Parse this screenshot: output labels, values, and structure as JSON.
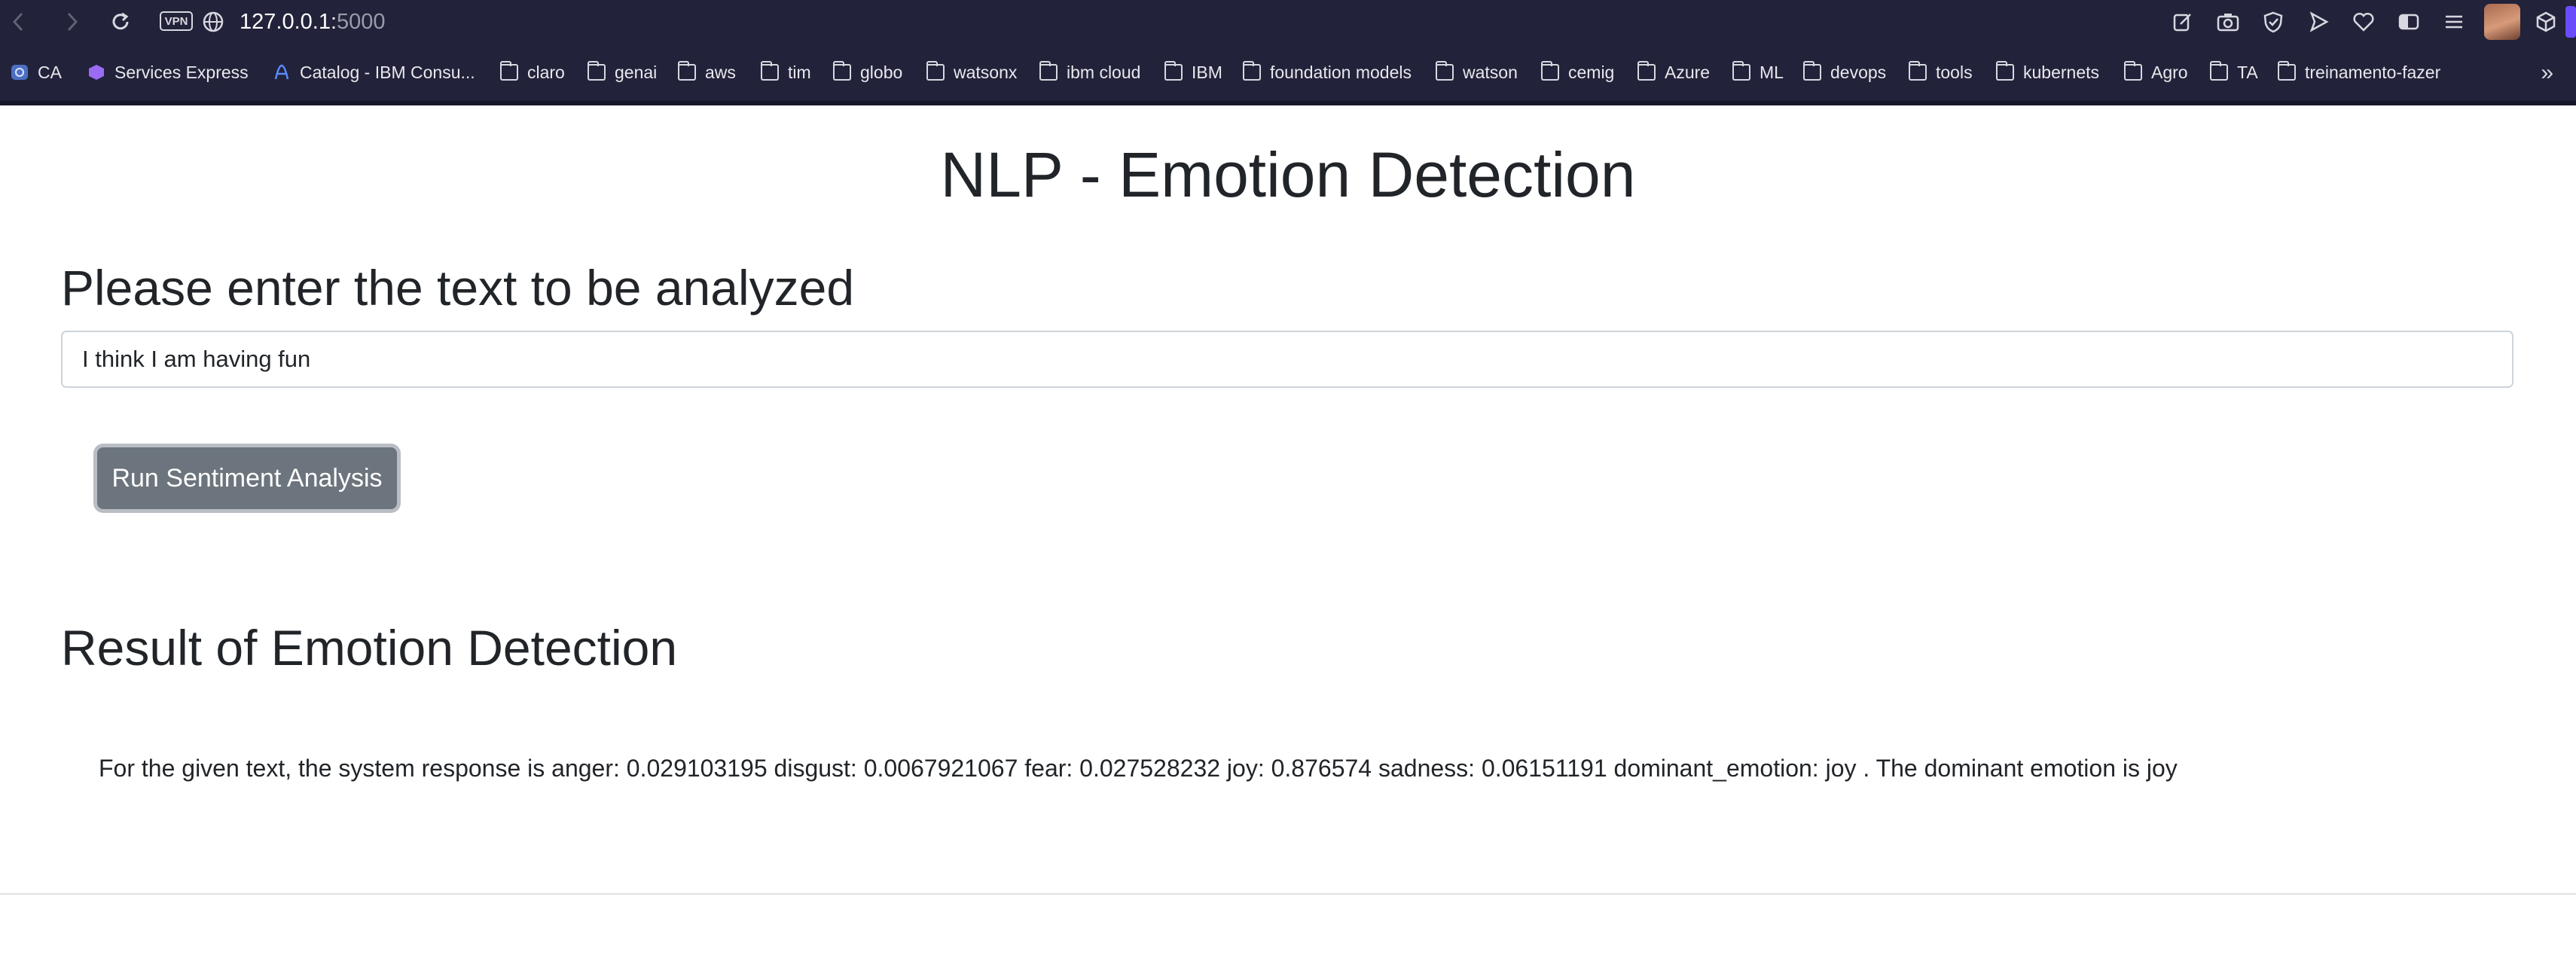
{
  "browser": {
    "url_host": "127.0.0.1:",
    "url_port": "5000",
    "vpn_label": "VPN",
    "toolbar_icons": [
      "edit-icon",
      "camera-icon",
      "shield-icon",
      "send-icon",
      "heart-icon",
      "sidebar-icon",
      "menu-icon",
      "avatar",
      "extensions-icon"
    ],
    "bookmarks": [
      {
        "label": "CA",
        "icon": "ca-icon"
      },
      {
        "label": "Services Express",
        "icon": "services-icon"
      },
      {
        "label": "Catalog - IBM Consu...",
        "icon": "catalog-icon"
      },
      {
        "label": "claro",
        "icon": "folder-icon"
      },
      {
        "label": "genai",
        "icon": "folder-icon"
      },
      {
        "label": "aws",
        "icon": "folder-icon"
      },
      {
        "label": "tim",
        "icon": "folder-icon"
      },
      {
        "label": "globo",
        "icon": "folder-icon"
      },
      {
        "label": "watsonx",
        "icon": "folder-icon"
      },
      {
        "label": "ibm cloud",
        "icon": "folder-icon"
      },
      {
        "label": "IBM",
        "icon": "folder-icon"
      },
      {
        "label": "foundation models",
        "icon": "folder-icon"
      },
      {
        "label": "watson",
        "icon": "folder-icon"
      },
      {
        "label": "cemig",
        "icon": "folder-icon"
      },
      {
        "label": "Azure",
        "icon": "folder-icon"
      },
      {
        "label": "ML",
        "icon": "folder-icon"
      },
      {
        "label": "devops",
        "icon": "folder-icon"
      },
      {
        "label": "tools",
        "icon": "folder-icon"
      },
      {
        "label": "kubernets",
        "icon": "folder-icon"
      },
      {
        "label": "Agro",
        "icon": "folder-icon"
      },
      {
        "label": "TA",
        "icon": "folder-icon"
      },
      {
        "label": "treinamento-fazer",
        "icon": "folder-icon"
      }
    ],
    "more_label": "»"
  },
  "page": {
    "title": "NLP - Emotion Detection",
    "prompt_heading": "Please enter the text to be analyzed",
    "text_input_value": "I think I am having fun",
    "run_button_label": "Run Sentiment Analysis",
    "result_heading": "Result of Emotion Detection",
    "response_text": "For the given text, the system response is anger: 0.029103195 disgust: 0.0067921067 fear: 0.027528232 joy: 0.876574 sadness: 0.06151191 dominant_emotion: joy . The dominant emotion is joy"
  }
}
